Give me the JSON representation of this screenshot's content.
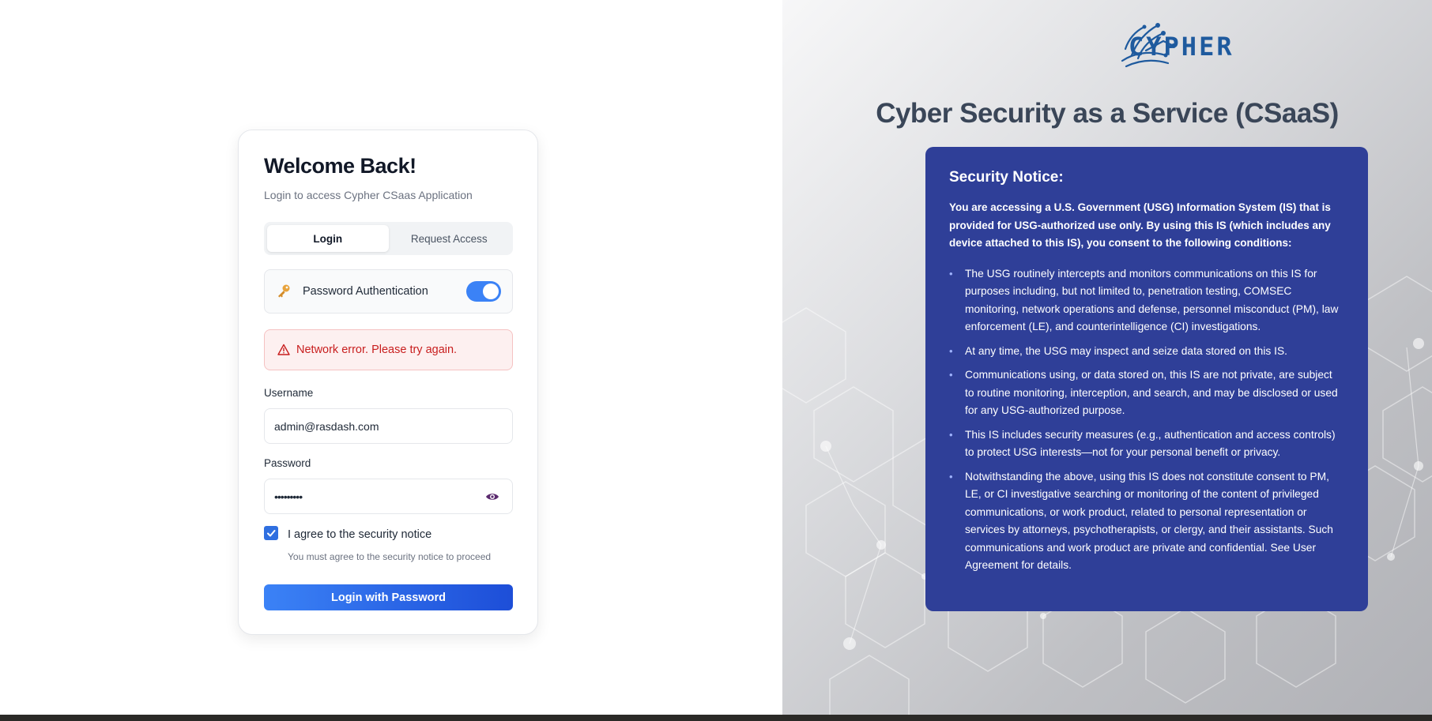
{
  "login_card": {
    "title": "Welcome Back!",
    "subtitle": "Login to access Cypher CSaas Application",
    "tabs": [
      {
        "label": "Login",
        "active": true
      },
      {
        "label": "Request Access",
        "active": false
      }
    ],
    "auth_method": {
      "label": "Password Authentication",
      "icon": "key-icon",
      "enabled": true
    },
    "error_message": "Network error. Please try again.",
    "username": {
      "label": "Username",
      "value": "admin@rasdash.com"
    },
    "password": {
      "label": "Password",
      "value": "•••••••••"
    },
    "agreement": {
      "checked": true,
      "label": "I agree to the security notice",
      "hint": "You must agree to the security notice to proceed"
    },
    "submit_label": "Login with Password"
  },
  "brand": {
    "logo_text": "CYPHER",
    "headline": "Cyber Security as a Service (CSaaS)"
  },
  "notice": {
    "title": "Security Notice:",
    "intro": "You are accessing a U.S. Government (USG) Information System (IS) that is provided for USG-authorized use only. By using this IS (which includes any device attached to this IS), you consent to the following conditions:",
    "items": [
      "The USG routinely intercepts and monitors communications on this IS for purposes including, but not limited to, penetration testing, COMSEC monitoring, network operations and defense, personnel misconduct (PM), law enforcement (LE), and counterintelligence (CI) investigations.",
      "At any time, the USG may inspect and seize data stored on this IS.",
      "Communications using, or data stored on, this IS are not private, are subject to routine monitoring, interception, and search, and may be disclosed or used for any USG-authorized purpose.",
      "This IS includes security measures (e.g., authentication and access controls) to protect USG interests—not for your personal benefit or privacy.",
      "Notwithstanding the above, using this IS does not constitute consent to PM, LE, or CI investigative searching or monitoring of the content of privileged communications, or work product, related to personal representation or services by attorneys, psychotherapists, or clergy, and their assistants. Such communications and work product are private and confidential. See User Agreement for details."
    ]
  },
  "colors": {
    "primary": "#3b82f6",
    "notice_bg": "#2f3f98",
    "error_text": "#c81e1e",
    "brand_blue": "#1e5a9e"
  }
}
